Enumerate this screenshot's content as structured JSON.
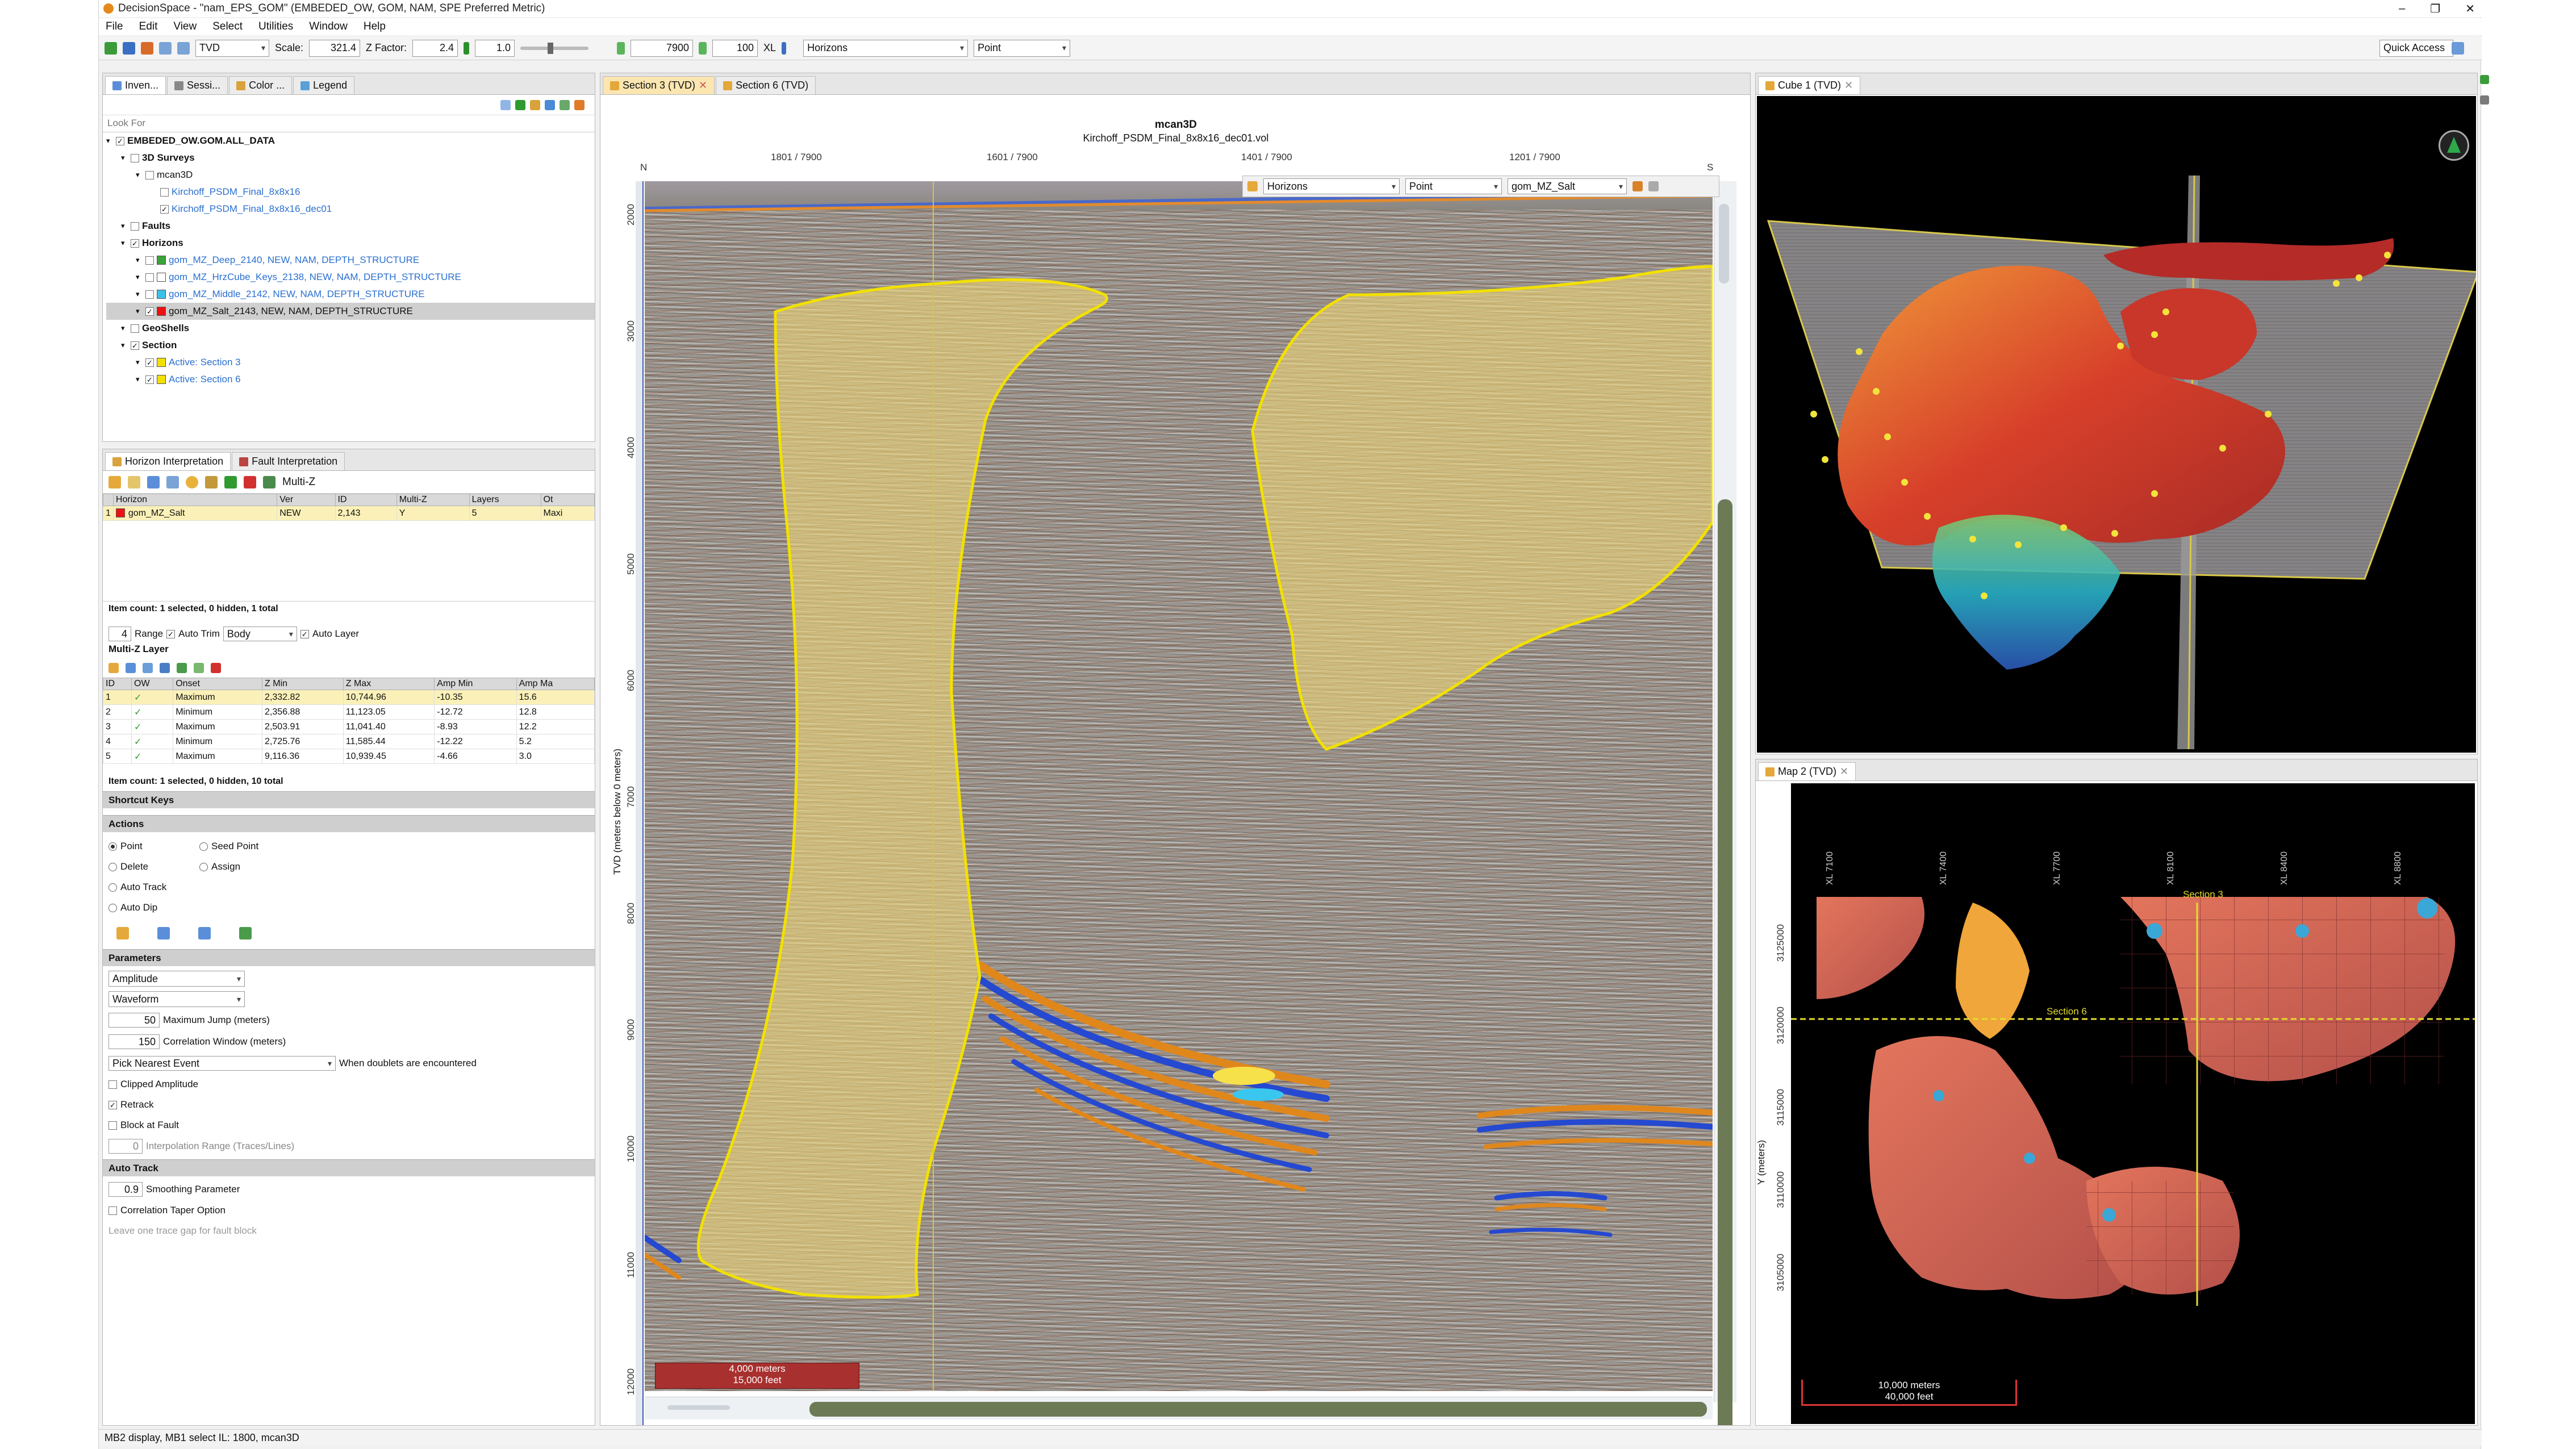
{
  "window": {
    "title": "DecisionSpace - \"nam_EPS_GOM\" (EMBEDED_OW, GOM, NAM, SPE Preferred Metric)"
  },
  "menu": [
    "File",
    "Edit",
    "View",
    "Select",
    "Utilities",
    "Window",
    "Help"
  ],
  "toolbar": {
    "domain": "TVD",
    "scale_label": "Scale:",
    "scale_value": "321.4",
    "zfactor_label": "Z Factor:",
    "zfactor_value": "2.4",
    "field1": "1.0",
    "line_value": "7900",
    "step_value": "100",
    "line_type": "XL",
    "layer_select": "Horizons",
    "mode_select": "Point",
    "quick_access": "Quick Access"
  },
  "inventory": {
    "tabs": [
      "Inven...",
      "Sessi...",
      "Color ...",
      "Legend"
    ],
    "search_placeholder": "Look For",
    "tree": [
      {
        "label": "EMBEDED_OW.GOM.ALL_DATA",
        "level": 0,
        "bold": true
      },
      {
        "label": "3D Surveys",
        "level": 1,
        "bold": true
      },
      {
        "label": "mcan3D",
        "level": 2
      },
      {
        "label": "Kirchoff_PSDM_Final_8x8x16",
        "level": 3,
        "blue": true
      },
      {
        "label": "Kirchoff_PSDM_Final_8x8x16_dec01",
        "level": 3,
        "blue": true
      },
      {
        "label": "Faults",
        "level": 1,
        "bold": true
      },
      {
        "label": "Horizons",
        "level": 1,
        "bold": true
      },
      {
        "label": "gom_MZ_Deep_2140, NEW, NAM, DEPTH_STRUCTURE",
        "level": 2,
        "blue": true,
        "color": "#3aa33a"
      },
      {
        "label": "gom_MZ_HrzCube_Keys_2138, NEW, NAM, DEPTH_STRUCTURE",
        "level": 2,
        "blue": true,
        "color": "#ffffff"
      },
      {
        "label": "gom_MZ_Middle_2142, NEW, NAM, DEPTH_STRUCTURE",
        "level": 2,
        "blue": true,
        "color": "#3bc1e6"
      },
      {
        "label": "gom_MZ_Salt_2143, NEW, NAM, DEPTH_STRUCTURE",
        "level": 2,
        "selected": true,
        "color": "#e11"
      },
      {
        "label": "GeoShells",
        "level": 1,
        "bold": true
      },
      {
        "label": "Section",
        "level": 1,
        "bold": true
      },
      {
        "label": "Active: Section 3",
        "level": 2,
        "blue": true,
        "color": "#f4e000"
      },
      {
        "label": "Active: Section 6",
        "level": 2,
        "blue": true,
        "color": "#f4e000"
      }
    ]
  },
  "horizon_interp": {
    "tabs": [
      "Horizon Interpretation",
      "Fault Interpretation"
    ],
    "multi_z": "Multi-Z",
    "columns": [
      "",
      "Horizon",
      "Ver",
      "ID",
      "Multi-Z",
      "Layers",
      "Ot"
    ],
    "rows": [
      [
        "1",
        "gom_MZ_Salt",
        "NEW",
        "2,143",
        "Y",
        "5",
        "Maxi"
      ]
    ],
    "item_count": "Item count: 1 selected, 0 hidden, 1 total",
    "range_value": "4",
    "range_label": "Range",
    "auto_trim": "Auto Trim",
    "body_select": "Body",
    "auto_layer": "Auto Layer",
    "multi_z_layer": "Multi-Z Layer",
    "layer_columns": [
      "ID",
      "OW",
      "Onset",
      "Z Min",
      "Z Max",
      "Amp Min",
      "Amp Ma"
    ],
    "layer_rows": [
      [
        "1",
        "✓",
        "Maximum",
        "2,332.82",
        "10,744.96",
        "-10.35",
        "15.6"
      ],
      [
        "2",
        "✓",
        "Minimum",
        "2,356.88",
        "11,123.05",
        "-12.72",
        "12.8"
      ],
      [
        "3",
        "✓",
        "Maximum",
        "2,503.91",
        "11,041.40",
        "-8.93",
        "12.2"
      ],
      [
        "4",
        "✓",
        "Minimum",
        "2,725.76",
        "11,585.44",
        "-12.22",
        "5.2"
      ],
      [
        "5",
        "✓",
        "Maximum",
        "9,116.36",
        "10,939.45",
        "-4.66",
        "3.0"
      ]
    ],
    "layer_count": "Item count: 1 selected, 0 hidden, 10 total",
    "shortcut_keys": "Shortcut Keys",
    "actions": "Actions",
    "action_items": [
      "Point",
      "Seed Point",
      "Delete",
      "Assign",
      "Auto Track",
      "Auto Dip"
    ],
    "parameters": "Parameters",
    "param_attr": "Amplitude",
    "param_mode": "Waveform",
    "max_jump_value": "50",
    "max_jump_label": "Maximum Jump (meters)",
    "corr_window_value": "150",
    "corr_window_label": "Correlation Window (meters)",
    "pick_select": "Pick Nearest Event",
    "pick_label": "When doublets are encountered",
    "clipped": "Clipped Amplitude",
    "retrack": "Retrack",
    "block_fault": "Block at Fault",
    "interp_value": "0",
    "interp_label": "Interpolation Range (Traces/Lines)",
    "auto_track": "Auto Track",
    "smooth_value": "0.9",
    "smooth_label": "Smoothing Parameter",
    "corr_taper": "Correlation Taper Option",
    "leave_gap": "Leave one trace gap for fault block"
  },
  "section_view": {
    "tabs": [
      "Section 3 (TVD)",
      "Section 6 (TVD)"
    ],
    "title": "mcan3D",
    "subtitle": "Kirchoff_PSDM_Final_8x8x16_dec01.vol",
    "top_ticks": [
      "1801 / 7900",
      "1601 / 7900",
      "1401 / 7900",
      "1201 / 7900"
    ],
    "n_label": "N",
    "s_label": "S",
    "z_ticks": [
      "2000",
      "3000",
      "4000",
      "5000",
      "6000",
      "7000",
      "8000",
      "9000",
      "10000",
      "11000",
      "12000"
    ],
    "z_label": "TVD (meters below 0 meters)",
    "inner_toolbar": {
      "layer": "Horizons",
      "mode": "Point",
      "horizon": "gom_MZ_Salt"
    },
    "scale_m": "4,000 meters",
    "scale_ft": "15,000 feet"
  },
  "cube_view": {
    "tab": "Cube 1 (TVD)"
  },
  "map_view": {
    "tab": "Map 2 (TVD)",
    "x_ticks": [
      "XL 7100",
      "XL 7400",
      "XL 7700",
      "XL 8100",
      "XL 8400",
      "XL 8800"
    ],
    "y_ticks": [
      "3125000",
      "3120000",
      "3115000",
      "3110000",
      "3105000"
    ],
    "y_label": "Y (meters)",
    "section3": "Section 3",
    "section6": "Section 6",
    "scale_m": "10,000 meters",
    "scale_ft": "40,000 feet"
  },
  "status": "MB2 display, MB1 select  IL: 1800, mcan3D"
}
